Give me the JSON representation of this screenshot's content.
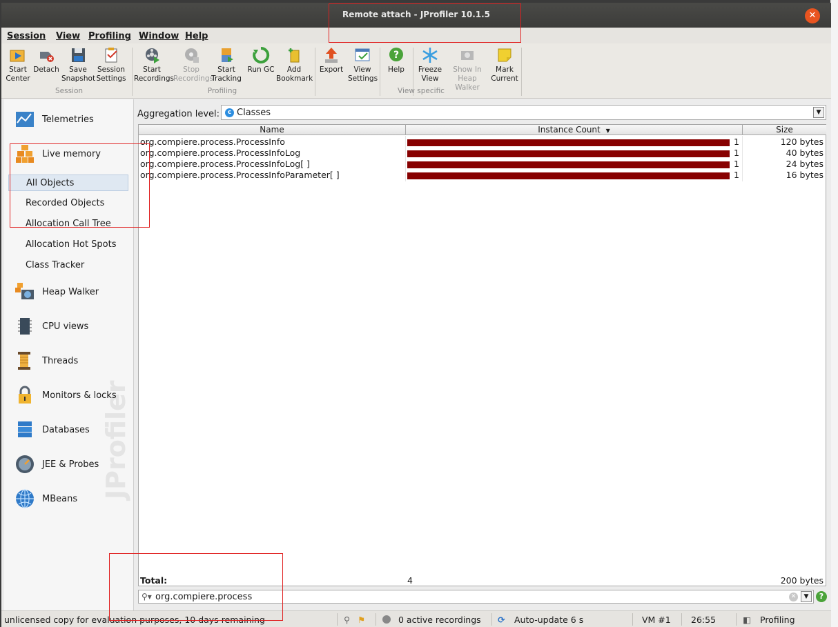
{
  "window": {
    "title": "Remote attach - JProfiler 10.1.5"
  },
  "menu": [
    "Session",
    "View",
    "Profiling",
    "Window",
    "Help"
  ],
  "toolbar": {
    "start_center": [
      "Start",
      "Center"
    ],
    "detach": [
      "Detach"
    ],
    "save_snapshot": [
      "Save",
      "Snapshot"
    ],
    "session_settings": [
      "Session",
      "Settings"
    ],
    "start_recordings": [
      "Start",
      "Recordings"
    ],
    "stop_recordings": [
      "Stop",
      "Recordings"
    ],
    "start_tracking": [
      "Start",
      "Tracking"
    ],
    "run_gc": [
      "Run GC"
    ],
    "add_bookmark": [
      "Add",
      "Bookmark"
    ],
    "export": [
      "Export"
    ],
    "view_settings": [
      "View",
      "Settings"
    ],
    "help": [
      "Help"
    ],
    "freeze_view": [
      "Freeze",
      "View"
    ],
    "show_in_heap_walker": [
      "Show In",
      "Heap Walker"
    ],
    "mark_current": [
      "Mark",
      "Current"
    ],
    "groups": {
      "session": "Session",
      "profiling": "Profiling",
      "view_specific": "View specific"
    }
  },
  "sidebar": {
    "telemetries": "Telemetries",
    "live_memory": "Live memory",
    "sub": [
      "All Objects",
      "Recorded Objects",
      "Allocation Call Tree",
      "Allocation Hot Spots",
      "Class Tracker"
    ],
    "heap_walker": "Heap Walker",
    "cpu_views": "CPU views",
    "threads": "Threads",
    "monitors": "Monitors & locks",
    "databases": "Databases",
    "jee_probes": "JEE & Probes",
    "mbeans": "MBeans",
    "watermark": "JProfiler"
  },
  "aggregation": {
    "label": "Aggregation level:",
    "value": "Classes"
  },
  "table": {
    "headers": {
      "name": "Name",
      "instance_count": "Instance Count",
      "size": "Size"
    },
    "rows": [
      {
        "name": "org.compiere.process.ProcessInfo",
        "count": "1",
        "size": "120 bytes"
      },
      {
        "name": "org.compiere.process.ProcessInfoLog",
        "count": "1",
        "size": "40 bytes"
      },
      {
        "name": "org.compiere.process.ProcessInfoLog[ ]",
        "count": "1",
        "size": "24 bytes"
      },
      {
        "name": "org.compiere.process.ProcessInfoParameter[ ]",
        "count": "1",
        "size": "16 bytes"
      }
    ],
    "total": {
      "label": "Total:",
      "count": "4",
      "size": "200 bytes"
    }
  },
  "search": {
    "value": "org.compiere.process"
  },
  "status": {
    "license": "unlicensed copy for evaluation purposes, 10 days remaining",
    "recordings": "0 active recordings",
    "auto_update": "Auto-update 6 s",
    "vm": "VM #1",
    "time": "26:55",
    "mode": "Profiling"
  },
  "colors": {
    "bar": "#870000",
    "close": "#e95420",
    "highlight_box": "#e02020",
    "selected": "#dfe8f2"
  }
}
